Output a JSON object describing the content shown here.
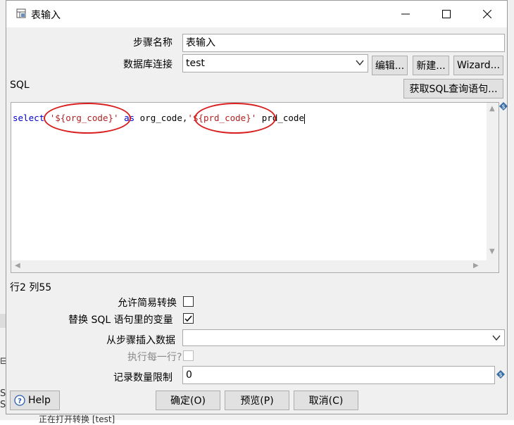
{
  "window": {
    "title": "表输入",
    "minimize_icon": "minimize-icon",
    "maximize_icon": "maximize-icon",
    "close_icon": "close-icon"
  },
  "form": {
    "step_name_label": "步骤名称",
    "step_name_value": "表输入",
    "db_conn_label": "数据库连接",
    "db_conn_value": "test",
    "edit_button": "编辑...",
    "new_button": "新建...",
    "wizard_button": "Wizard...",
    "sql_label": "SQL",
    "get_sql_button": "获取SQL查询语句...",
    "sql": {
      "kw_select": "select",
      "str_org": "'${org_code}'",
      "kw_as": "as",
      "mid": "org_code,",
      "str_prd": "'${prd_code}'",
      "tail": "prd_code"
    },
    "cursor_pos": "行2 列55",
    "lazy_conv_label": "允许简易转换",
    "lazy_conv_checked": false,
    "replace_vars_label": "替换 SQL 语句里的变量",
    "replace_vars_checked": true,
    "insert_from_step_label": "从步骤插入数据",
    "insert_from_step_value": "",
    "execute_each_row_label": "执行每一行?",
    "execute_each_row_checked": false,
    "limit_label": "记录数量限制",
    "limit_value": "0"
  },
  "footer": {
    "help_button": "Help",
    "ok_button": "确定(O)",
    "preview_button": "预览(P)",
    "cancel_button": "取消(C)"
  },
  "background": {
    "bottom_text": "正在打开转换 [test]"
  },
  "colors": {
    "highlight_ellipse": "#d81e1e",
    "sql_keyword": "#0000cc",
    "sql_string": "#b22222"
  }
}
